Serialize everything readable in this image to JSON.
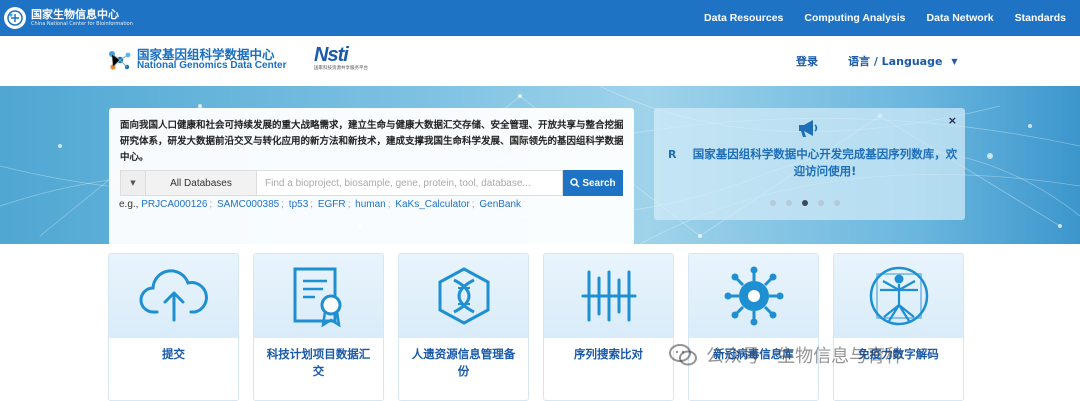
{
  "topbar": {
    "org_cn": "国家生物信息中心",
    "org_en": "China National Center for Bioinformation",
    "nav": [
      "Data Resources",
      "Computing Analysis",
      "Data Network",
      "Standards"
    ]
  },
  "header": {
    "ngdc_cn": "国家基因组科学数据中心",
    "ngdc_en": "National Genomics Data Center",
    "nsti_word": "Nsti",
    "nsti_sub": "国家科技资源共享服务平台",
    "login": "登录",
    "language": "语言 / Language"
  },
  "hero": {
    "mission": "面向我国人口健康和社会可持续发展的重大战略需求，建立生命与健康大数据汇交存储、安全管理、开放共享与整合挖掘研究体系，研发大数据前沿交叉与转化应用的新方法和新技术，建成支撑我国生命科学发展、国际领先的基因组科学数据中心。",
    "search": {
      "db_label": "All Databases",
      "placeholder": "Find a bioproject, biosample, gene, protein, tool, database...",
      "button": "Search"
    },
    "examples_prefix": "e.g.,",
    "examples": [
      "PRJCA000126",
      "SAMC000385",
      "tp53",
      "EGFR",
      "human",
      "KaKs_Calculator",
      "GenBank"
    ],
    "notice": {
      "prev_label": "R",
      "message": "国家基因组科学数据中心开发完成基因序列数库，欢迎访问使用!",
      "close": "×",
      "slides": 5,
      "active_slide": 3
    }
  },
  "cards": [
    {
      "label": "提交",
      "icon": "cloud-upload-icon"
    },
    {
      "label": "科技计划项目数据汇交",
      "icon": "certificate-icon"
    },
    {
      "label": "人遗资源信息管理备份",
      "icon": "dna-icon"
    },
    {
      "label": "序列搜索比对",
      "icon": "sequence-bars-icon"
    },
    {
      "label": "新冠病毒信息库",
      "icon": "virus-icon"
    },
    {
      "label": "免疫力数字解码",
      "icon": "vitruvian-icon"
    }
  ],
  "watermark": {
    "text": "公众号 · 生物信息与育种"
  },
  "colors": {
    "primary": "#1e73c4",
    "link": "#1a5aa8"
  }
}
